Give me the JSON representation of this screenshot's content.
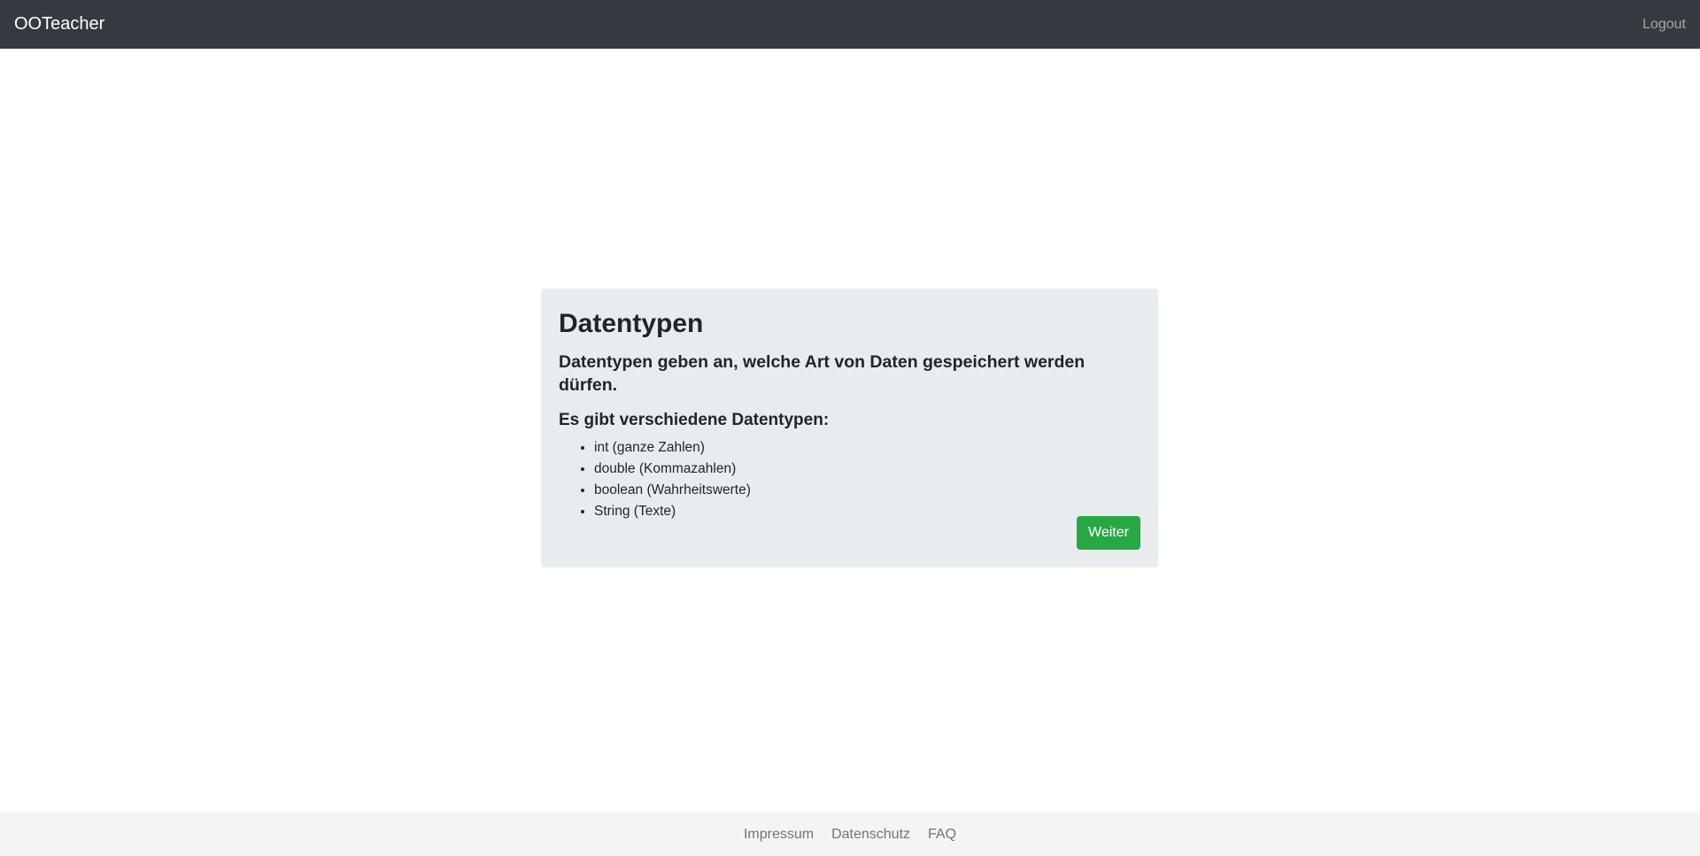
{
  "navbar": {
    "brand": "OOTeacher",
    "logout_label": "Logout"
  },
  "card": {
    "title": "Datentypen",
    "lead": "Datentypen geben an, welche Art von Daten gespeichert werden dürfen.",
    "subheading": "Es gibt verschiedene Datentypen:",
    "items": [
      "int (ganze Zahlen)",
      "double (Kommazahlen)",
      "boolean (Wahrheitswerte)",
      "String (Texte)"
    ],
    "next_button": "Weiter"
  },
  "footer": {
    "links": [
      "Impressum",
      "Datenschutz",
      "FAQ"
    ]
  },
  "colors": {
    "navbar_bg": "#343a40",
    "card_bg": "#e9ecef",
    "button_bg": "#28a745",
    "footer_bg": "#f4f4f4"
  }
}
